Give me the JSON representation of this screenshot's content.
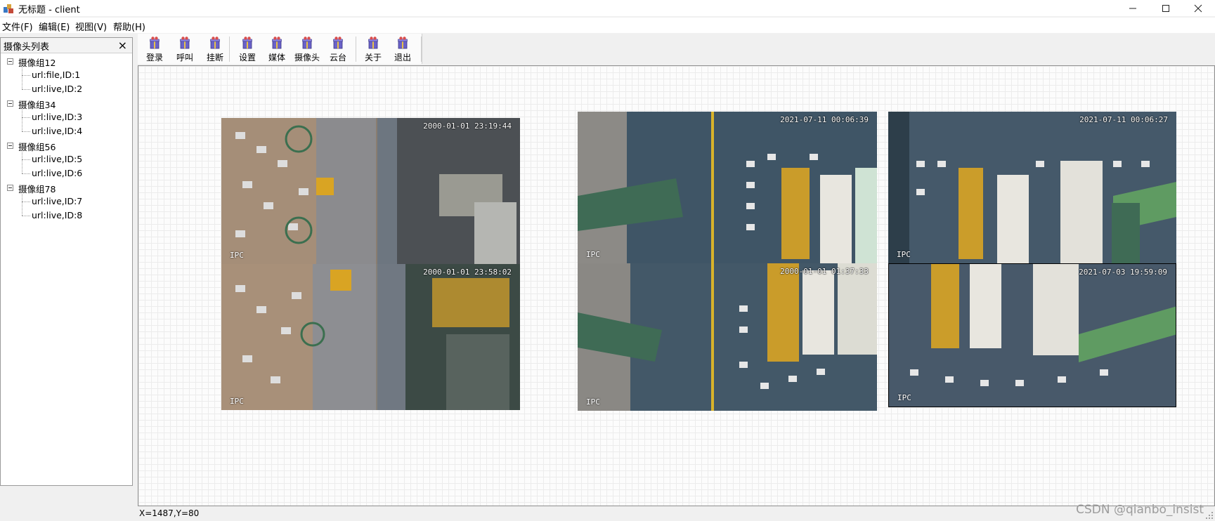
{
  "window": {
    "title": "无标题 - client",
    "controls": {
      "minimize": "minimize-icon",
      "maximize": "maximize-icon",
      "close": "close-icon"
    }
  },
  "menu": [
    "文件(F)",
    "编辑(E)",
    "视图(V)",
    "帮助(H)"
  ],
  "dock": {
    "title": "摄像头列表",
    "close_symbol": "×",
    "groups": [
      {
        "label": "摄像组12",
        "items": [
          "url:file,ID:1",
          "url:live,ID:2"
        ]
      },
      {
        "label": "摄像组34",
        "items": [
          "url:live,ID:3",
          "url:live,ID:4"
        ]
      },
      {
        "label": "摄像组56",
        "items": [
          "url:live,ID:5",
          "url:live,ID:6"
        ]
      },
      {
        "label": "摄像组78",
        "items": [
          "url:live,ID:7",
          "url:live,ID:8"
        ]
      }
    ]
  },
  "toolbar": {
    "buttons": [
      "登录",
      "呼叫",
      "挂断",
      "设置",
      "媒体",
      "摄像头",
      "云台",
      "关于",
      "退出"
    ],
    "icon": "gift-icon"
  },
  "videos": [
    {
      "timestamp": "2000-01-01 23:19:44",
      "label": "IPC"
    },
    {
      "timestamp": "2000-01-01 23:58:02",
      "label": "IPC"
    },
    {
      "timestamp": "2021-07-11 00:06:39",
      "label": "IPC"
    },
    {
      "timestamp": "2000-01-01 01:37:33",
      "label": "IPC"
    },
    {
      "timestamp": "2021-07-11 00:06:27",
      "label": "IPC"
    },
    {
      "timestamp": "2021-07-03 19:59:09",
      "label": "IPC"
    }
  ],
  "status": {
    "coords": "X=1487,Y=80",
    "watermark": "CSDN @qianbo_insist"
  },
  "colors": {
    "road": "#7d7f86",
    "asphalt": "#3e5566",
    "crane_yellow": "#d9a423",
    "crane_green": "#3f6b55",
    "container_white": "#e8e6df"
  }
}
